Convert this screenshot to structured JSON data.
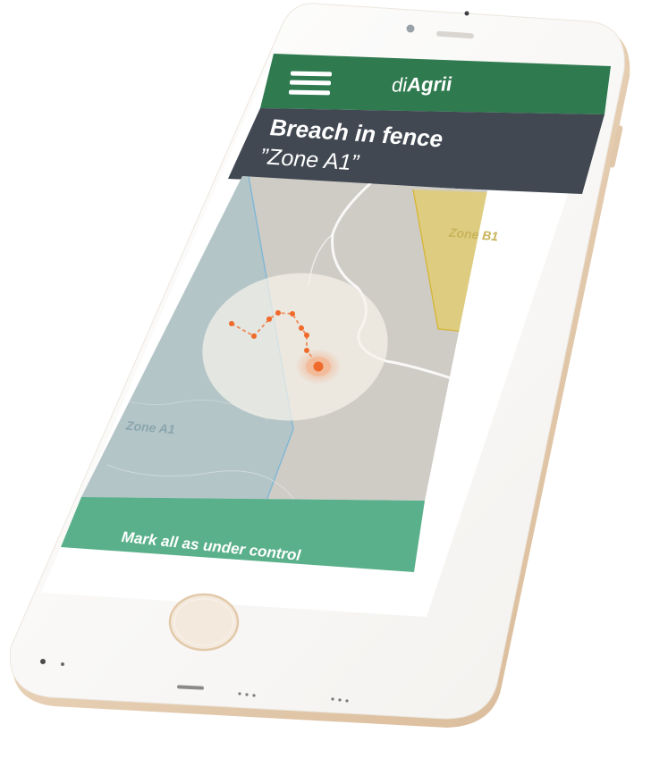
{
  "app": {
    "brand_prefix": "di",
    "brand_suffix": "Agrii"
  },
  "alert": {
    "title": "Breach in fence",
    "zone": "”Zone A1”"
  },
  "map": {
    "zones": [
      {
        "label": "Zone B1",
        "color": "#e3cd6a"
      },
      {
        "label": "Zone A1",
        "color": "#9fc0cb"
      }
    ]
  },
  "actions": {
    "mark_all_label": "Mark all as under control"
  },
  "colors": {
    "header_green": "#2f7a4f",
    "alert_bar": "#414852",
    "action_green": "#5ab08a",
    "breach_orange": "#ef6a2b",
    "phone_gold": "#e9d6bf"
  },
  "icons": {
    "menu": "hamburger-menu-icon"
  }
}
